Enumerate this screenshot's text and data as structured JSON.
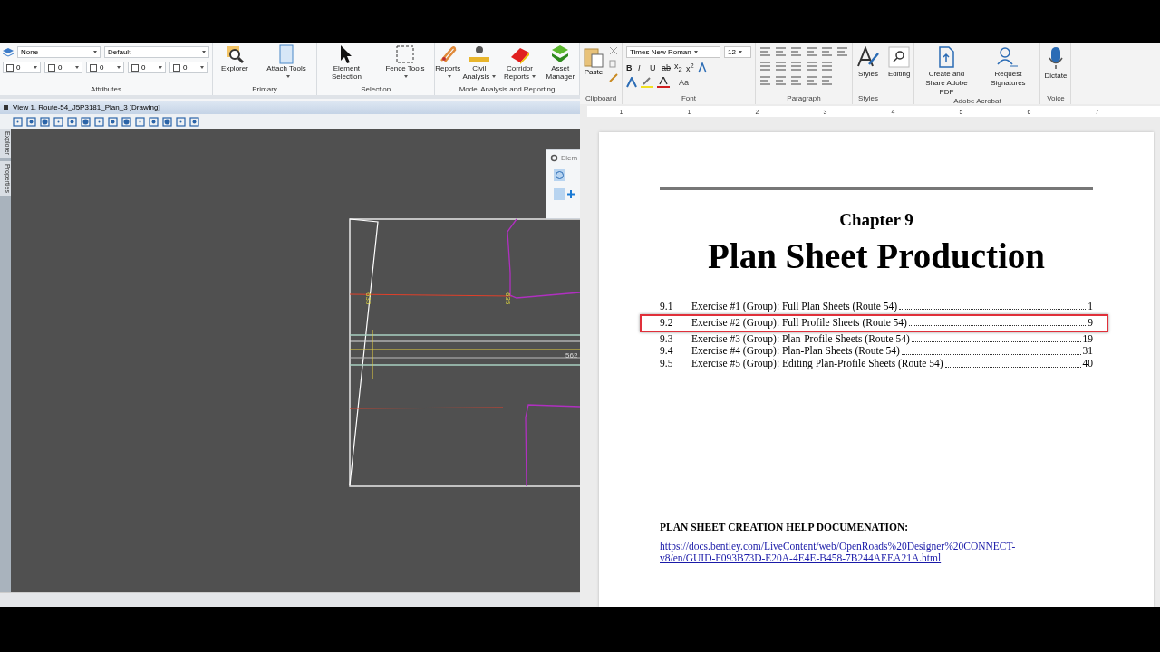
{
  "cad": {
    "level_field": "None",
    "style_field": "Default",
    "attribute_fields": [
      "0",
      "0",
      "0",
      "0",
      "0"
    ],
    "ribbon_groups": [
      {
        "name": "Attributes"
      },
      {
        "name": "Primary",
        "buttons": [
          {
            "label": "Explorer",
            "kind": "magnifier",
            "dropdown": false
          },
          {
            "label": "Attach Tools",
            "kind": "document",
            "dropdown": true
          }
        ]
      },
      {
        "name": "Selection",
        "buttons": [
          {
            "label": "Element Selection",
            "kind": "cursor",
            "dropdown": false
          },
          {
            "label": "Fence Tools",
            "kind": "fence",
            "dropdown": true
          }
        ]
      },
      {
        "name": "Model Analysis and Reporting",
        "buttons": [
          {
            "label": "Reports",
            "kind": "clip",
            "dropdown": true
          },
          {
            "label": "Civil Analysis",
            "kind": "ruler",
            "dropdown": true
          },
          {
            "label": "Corridor Reports",
            "kind": "book",
            "dropdown": true
          },
          {
            "label": "Asset Manager",
            "kind": "gem",
            "dropdown": false
          }
        ]
      }
    ],
    "view_title": "View 1, Route-54_J5P3181_Plan_3 [Drawing]",
    "side_tabs": [
      "Explorer",
      "Properties"
    ],
    "drawing_labels": [
      "635",
      "635",
      "562"
    ],
    "floating_panel": {
      "title": "Elem"
    }
  },
  "word": {
    "font_name": "Times New Roman",
    "font_size": "12",
    "format_buttons": [
      "B",
      "I",
      "U",
      "ab",
      "x$_{2}$",
      "x$^{2}$"
    ],
    "case_button": "Aa",
    "paste": "Paste",
    "big_buttons": [
      {
        "label": "Styles",
        "kind": "styles"
      },
      {
        "label": "Editing",
        "kind": "search"
      },
      {
        "label": "Create and Share Adobe PDF",
        "kind": "pdf"
      },
      {
        "label": "Request Signatures",
        "kind": "sign"
      },
      {
        "label": "Dictate",
        "kind": "mic"
      }
    ],
    "groups": [
      "Clipboard",
      "Font",
      "Paragraph",
      "Styles",
      "Adobe Acrobat",
      "Voice"
    ],
    "ruler_numbers": [
      "1",
      "1",
      "2",
      "3",
      "4",
      "5",
      "6",
      "7"
    ]
  },
  "document": {
    "chapter": "Chapter 9",
    "title": "Plan Sheet Production",
    "toc": [
      {
        "number": "9.1",
        "title": "Exercise #1 (Group): Full Plan Sheets (Route 54)",
        "page": "1",
        "highlighted": false
      },
      {
        "number": "9.2",
        "title": "Exercise #2 (Group): Full Profile Sheets (Route 54)",
        "page": "9",
        "highlighted": true
      },
      {
        "number": "9.3",
        "title": "Exercise #3 (Group): Plan-Profile Sheets (Route 54)",
        "page": "19",
        "highlighted": false
      },
      {
        "number": "9.4",
        "title": "Exercise #4 (Group): Plan-Plan Sheets (Route 54)",
        "page": "31",
        "highlighted": false
      },
      {
        "number": "9.5",
        "title": "Exercise #5 (Group): Editing Plan-Profile Sheets (Route 54)",
        "page": "40",
        "highlighted": false
      }
    ],
    "help_heading": "PLAN SHEET CREATION HELP DOCUMENATION:",
    "link": [
      "https://docs.bentley.com/LiveContent/web/OpenRoads%20Designer%20CONNECT-",
      "v8/en/GUID-F093B73D-E20A-4E4E-B458-7B244AEEA21A.html"
    ]
  }
}
